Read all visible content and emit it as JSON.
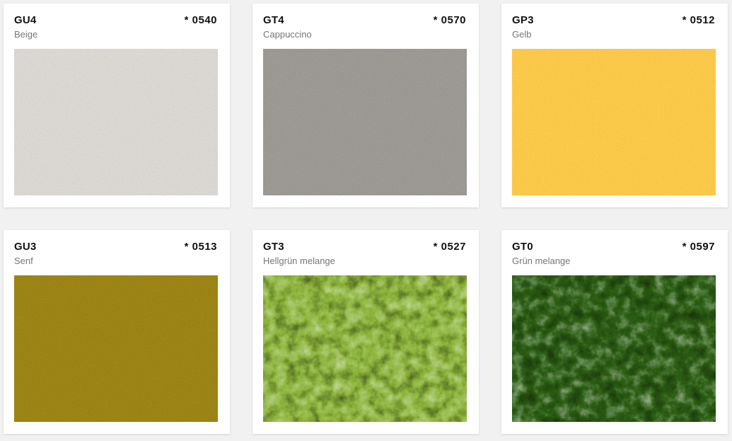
{
  "swatches": [
    {
      "code": "GU4",
      "number": "* 0540",
      "name": "Beige",
      "color": "#dcd8d4",
      "melange": false
    },
    {
      "code": "GT4",
      "number": "* 0570",
      "name": "Cappuccino",
      "color": "#9c9994",
      "melange": false
    },
    {
      "code": "GP3",
      "number": "* 0512",
      "name": "Gelb",
      "color": "#fdca48",
      "melange": false
    },
    {
      "code": "GU3",
      "number": "* 0513",
      "name": "Senf",
      "color": "#9c8412",
      "melange": false
    },
    {
      "code": "GT3",
      "number": "* 0527",
      "name": "Hellgrün melange",
      "color": "#8db43c",
      "melange": true
    },
    {
      "code": "GT0",
      "number": "* 0597",
      "name": "Grün melange",
      "color": "#2c5e14",
      "melange": true
    }
  ]
}
